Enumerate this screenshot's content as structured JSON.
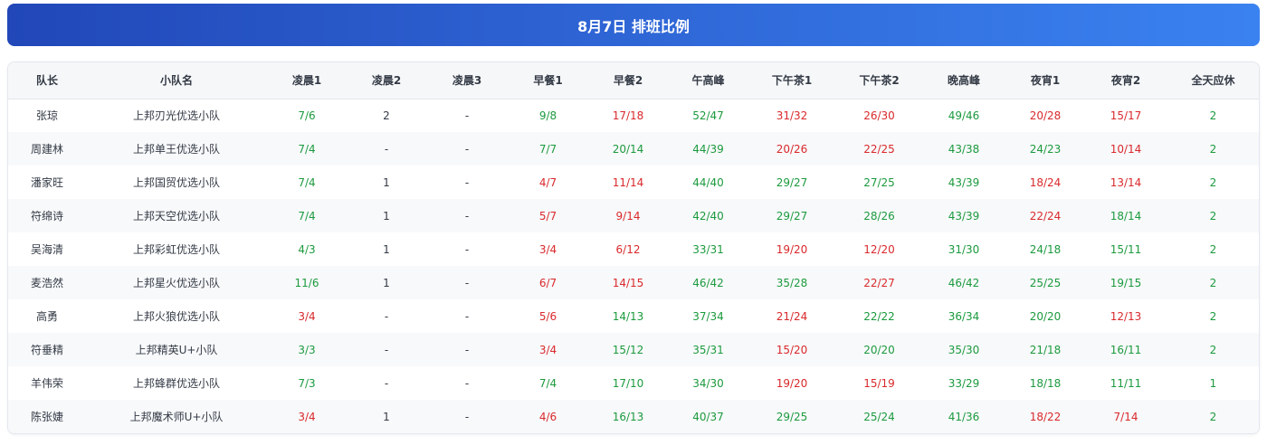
{
  "title": "8月7日 排班比例",
  "colors": {
    "header_gradient_start": "#2147b8",
    "header_gradient_end": "#3a82f0",
    "good": "#1c9a3e",
    "bad": "#d9292c",
    "neutral": "#333a45"
  },
  "table": {
    "columns": [
      "队长",
      "小队名",
      "凌晨1",
      "凌晨2",
      "凌晨3",
      "早餐1",
      "早餐2",
      "午高峰",
      "下午茶1",
      "下午茶2",
      "晚高峰",
      "夜宵1",
      "夜宵2",
      "全天应休"
    ],
    "rows": [
      {
        "cells": [
          "张琼",
          "上邦刃光优选小队",
          "7/6",
          "2",
          "-",
          "9/8",
          "17/18",
          "52/47",
          "31/32",
          "26/30",
          "49/46",
          "20/28",
          "15/17",
          "2"
        ],
        "status": [
          "neutral",
          "neutral",
          "good",
          "neutral",
          "neutral",
          "good",
          "bad",
          "good",
          "bad",
          "bad",
          "good",
          "bad",
          "bad",
          "good"
        ]
      },
      {
        "cells": [
          "周建林",
          "上邦单王优选小队",
          "7/4",
          "-",
          "-",
          "7/7",
          "20/14",
          "44/39",
          "20/26",
          "22/25",
          "43/38",
          "24/23",
          "10/14",
          "2"
        ],
        "status": [
          "neutral",
          "neutral",
          "good",
          "neutral",
          "neutral",
          "good",
          "good",
          "good",
          "bad",
          "bad",
          "good",
          "good",
          "bad",
          "good"
        ]
      },
      {
        "cells": [
          "潘家旺",
          "上邦国贸优选小队",
          "7/4",
          "1",
          "-",
          "4/7",
          "11/14",
          "44/40",
          "29/27",
          "27/25",
          "43/39",
          "18/24",
          "13/14",
          "2"
        ],
        "status": [
          "neutral",
          "neutral",
          "good",
          "neutral",
          "neutral",
          "bad",
          "bad",
          "good",
          "good",
          "good",
          "good",
          "bad",
          "bad",
          "good"
        ]
      },
      {
        "cells": [
          "符绵诗",
          "上邦天空优选小队",
          "7/4",
          "1",
          "-",
          "5/7",
          "9/14",
          "42/40",
          "29/27",
          "28/26",
          "43/39",
          "22/24",
          "18/14",
          "2"
        ],
        "status": [
          "neutral",
          "neutral",
          "good",
          "neutral",
          "neutral",
          "bad",
          "bad",
          "good",
          "good",
          "good",
          "good",
          "bad",
          "good",
          "good"
        ]
      },
      {
        "cells": [
          "吴海清",
          "上邦彩虹优选小队",
          "4/3",
          "1",
          "-",
          "3/4",
          "6/12",
          "33/31",
          "19/20",
          "12/20",
          "31/30",
          "24/18",
          "15/11",
          "2"
        ],
        "status": [
          "neutral",
          "neutral",
          "good",
          "neutral",
          "neutral",
          "bad",
          "bad",
          "good",
          "bad",
          "bad",
          "good",
          "good",
          "good",
          "good"
        ]
      },
      {
        "cells": [
          "麦浩然",
          "上邦星火优选小队",
          "11/6",
          "1",
          "-",
          "6/7",
          "14/15",
          "46/42",
          "35/28",
          "22/27",
          "46/42",
          "25/25",
          "19/15",
          "2"
        ],
        "status": [
          "neutral",
          "neutral",
          "good",
          "neutral",
          "neutral",
          "bad",
          "bad",
          "good",
          "good",
          "bad",
          "good",
          "good",
          "good",
          "good"
        ]
      },
      {
        "cells": [
          "高勇",
          "上邦火狼优选小队",
          "3/4",
          "-",
          "-",
          "5/6",
          "14/13",
          "37/34",
          "21/24",
          "22/22",
          "36/34",
          "20/20",
          "12/13",
          "2"
        ],
        "status": [
          "neutral",
          "neutral",
          "bad",
          "neutral",
          "neutral",
          "bad",
          "good",
          "good",
          "bad",
          "good",
          "good",
          "good",
          "bad",
          "good"
        ]
      },
      {
        "cells": [
          "符垂精",
          "上邦精英U+小队",
          "3/3",
          "-",
          "-",
          "3/4",
          "15/12",
          "35/31",
          "15/20",
          "20/20",
          "35/30",
          "21/18",
          "16/11",
          "2"
        ],
        "status": [
          "neutral",
          "neutral",
          "good",
          "neutral",
          "neutral",
          "bad",
          "good",
          "good",
          "bad",
          "good",
          "good",
          "good",
          "good",
          "good"
        ]
      },
      {
        "cells": [
          "羊伟荣",
          "上邦蜂群优选小队",
          "7/3",
          "-",
          "-",
          "7/4",
          "17/10",
          "34/30",
          "19/20",
          "15/19",
          "33/29",
          "18/18",
          "11/11",
          "1"
        ],
        "status": [
          "neutral",
          "neutral",
          "good",
          "neutral",
          "neutral",
          "good",
          "good",
          "good",
          "bad",
          "bad",
          "good",
          "good",
          "good",
          "good"
        ]
      },
      {
        "cells": [
          "陈张婕",
          "上邦魔术师U+小队",
          "3/4",
          "1",
          "-",
          "4/6",
          "16/13",
          "40/37",
          "29/25",
          "25/24",
          "41/36",
          "18/22",
          "7/14",
          "2"
        ],
        "status": [
          "neutral",
          "neutral",
          "bad",
          "neutral",
          "neutral",
          "bad",
          "good",
          "good",
          "good",
          "good",
          "good",
          "bad",
          "bad",
          "good"
        ]
      }
    ]
  }
}
